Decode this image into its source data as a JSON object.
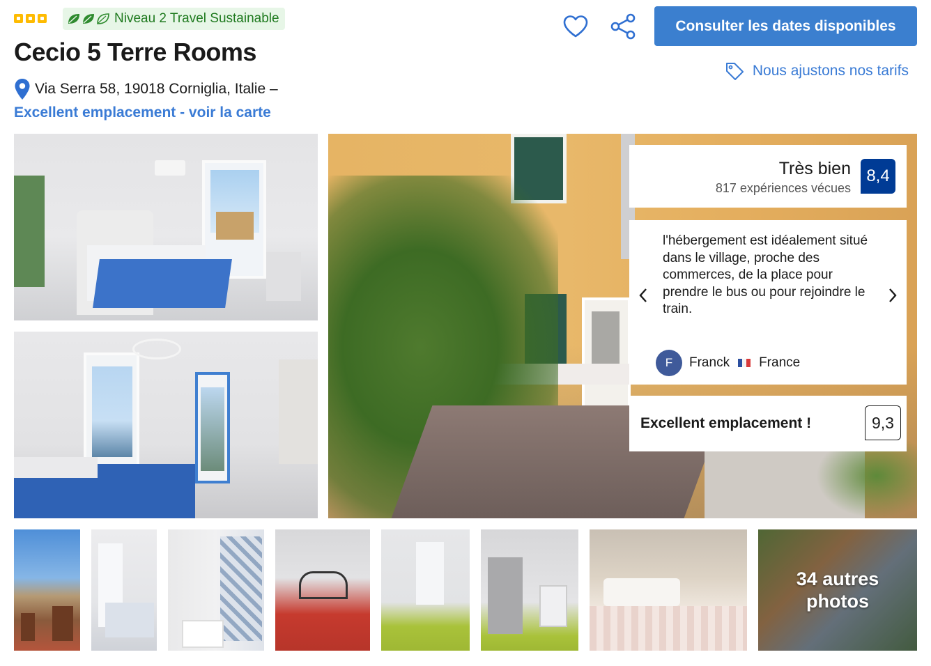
{
  "header": {
    "star_rating": 3,
    "sustainability_label": "Niveau 2 Travel Sustainable",
    "hotel_name": "Cecio 5 Terre Rooms",
    "address": "Via Serra 58, 19018 Corniglia, Italie –",
    "map_link_label": "Excellent emplacement - voir la carte",
    "cta_label": "Consulter les dates disponibles",
    "price_match_label": "Nous ajustons nos tarifs",
    "icons": {
      "favorite": "heart-icon",
      "share": "share-icon",
      "price_tag": "tag-icon",
      "location": "map-pin-icon"
    }
  },
  "review_summary": {
    "rating_label": "Très bien",
    "review_count_label": "817 expériences vécues",
    "score": "8,4"
  },
  "featured_review": {
    "text": "l'hébergement est idéalement situé dans le village, proche des commerces, de la place pour prendre le bus ou pour rejoindre le train.",
    "reviewer_initial": "F",
    "reviewer_name": "Franck",
    "reviewer_country": "France"
  },
  "location_rating": {
    "label": "Excellent emplacement !",
    "score": "9,3"
  },
  "gallery": {
    "more_photos_count": "34 autres",
    "more_photos_suffix": "photos"
  },
  "colors": {
    "brand_blue": "#3b7fcf",
    "link_blue": "#3a7bd5",
    "score_navy": "#003b95",
    "star_yellow": "#febb02",
    "sustainability_green": "#1f7a1f"
  }
}
